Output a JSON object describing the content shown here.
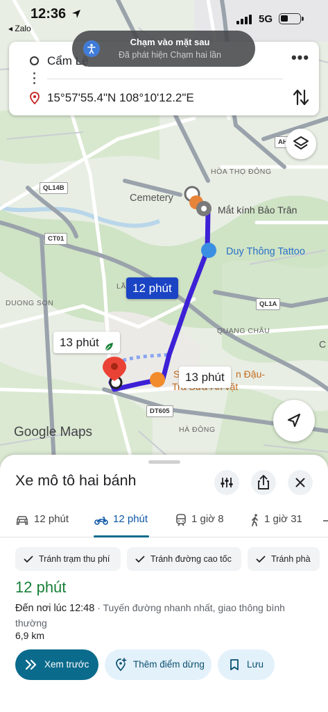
{
  "status_bar": {
    "time": "12:36",
    "back_app": "◂ Zalo",
    "network": "5G"
  },
  "toast": {
    "title": "Chạm vào mặt sau",
    "subtitle": "Đã phát hiện Chạm hai lần"
  },
  "directions": {
    "origin": "Cẩm Lệ",
    "destination": "15°57'55.4\"N 108°10'12.2\"E",
    "more_icon": "more-horiz-icon",
    "swap_icon": "swap-vertical-icon"
  },
  "map": {
    "labels": {
      "cemetery": "Cemetery",
      "optical": "Mắt kính Bảo Trân",
      "tattoo": "Duy Thông Tattoo",
      "hoa_tho_dong": "HÒA THỌ ĐÔNG",
      "duong_son": "DUONG SON",
      "quang_chau": "QUANG CHÂU",
      "ha_dong": "HÀ ĐÔNG",
      "lam": "LẦ",
      "c_edge": "C",
      "restaurant_a": "S",
      "restaurant_b": "n Đậu-",
      "restaurant_c": "Trà Sữa-Ăn vặt"
    },
    "shields": {
      "ah": "AH",
      "ql14b": "QL14B",
      "ct01": "CT01",
      "ql1a": "QL1A",
      "dt605": "DT605"
    },
    "route_main_eta": "12 phút",
    "route_alt1_eta": "13 phút",
    "route_alt2_eta": "13 phút",
    "leaf_icon": "eco-leaf-icon",
    "attribution": "Google Maps",
    "colors": {
      "route": "#3c21d6",
      "route_alt": "#8aa6f0",
      "bubble": "#1a44c4"
    }
  },
  "sheet": {
    "title": "Xe mô tô hai bánh",
    "tabs": [
      {
        "label": "12 phút",
        "icon": "car-icon"
      },
      {
        "label": "12 phút",
        "icon": "motorbike-icon"
      },
      {
        "label": "1 giờ 8",
        "icon": "transit-icon"
      },
      {
        "label": "1 giờ 31",
        "icon": "walk-icon"
      }
    ],
    "chips": [
      {
        "label": "Tránh trạm thu phí"
      },
      {
        "label": "Tránh đường cao tốc"
      },
      {
        "label": "Tránh phà"
      }
    ],
    "eta": "12 phút",
    "arrive_time": "Đến nơi lúc 12:48",
    "arrive_note": " · Tuyến đường nhanh nhất, giao thông bình thường",
    "distance": "6,9 km",
    "buttons": {
      "preview": "Xem trước",
      "add_stop": "Thêm điểm dừng",
      "save": "Lưu"
    },
    "accent": "#0b6b8c",
    "eta_color": "#188038"
  }
}
